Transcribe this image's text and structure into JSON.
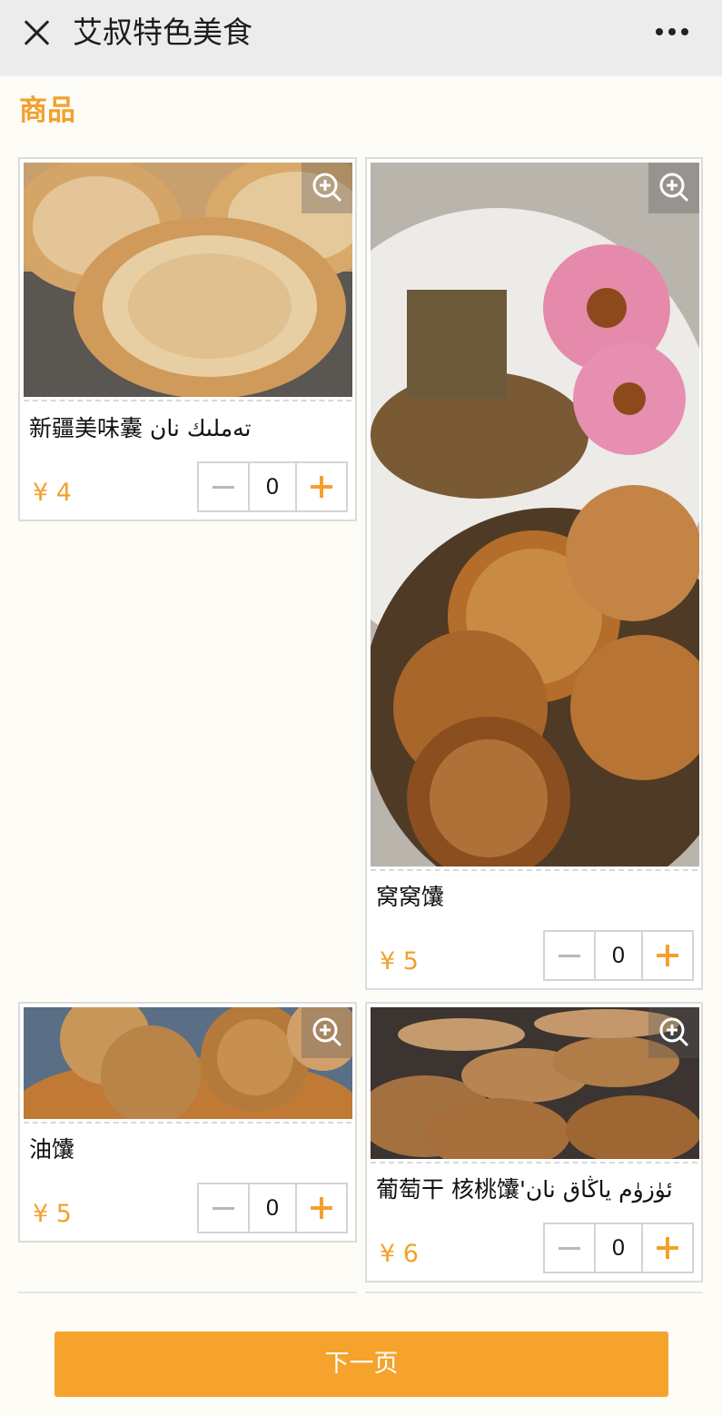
{
  "header": {
    "title": "艾叔特色美食"
  },
  "section": {
    "title": "商品"
  },
  "products": [
    {
      "name": "新疆美味囊 تەملىك نان",
      "currency": "¥",
      "price": "4",
      "qty": "0"
    },
    {
      "name": "窝窝馕",
      "currency": "¥",
      "price": "5",
      "qty": "0"
    },
    {
      "name": "油馕",
      "currency": "¥",
      "price": "5",
      "qty": "0"
    },
    {
      "name": "葡萄干 核桃馕'ئۈزۈم ياڭاق نان",
      "currency": "¥",
      "price": "6",
      "qty": "0"
    }
  ],
  "footer": {
    "next_label": "下一页"
  },
  "colors": {
    "accent": "#f5a32c",
    "price": "#f2a12d"
  }
}
